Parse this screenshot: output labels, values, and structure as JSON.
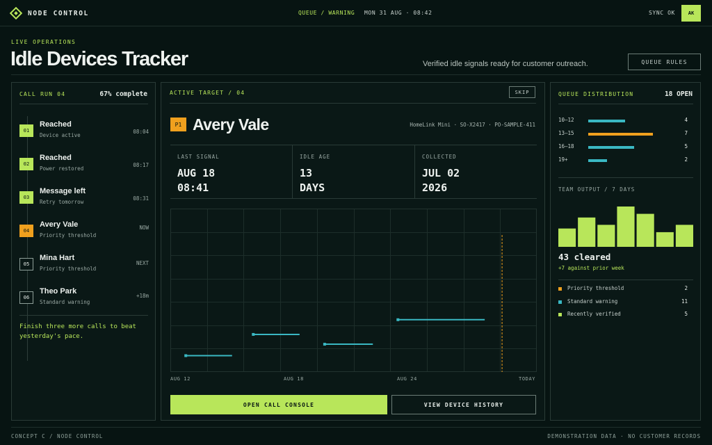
{
  "app": {
    "name": "NODE CONTROL",
    "status": "QUEUE / WARNING",
    "datetime": "MON 31 AUG · 08:42",
    "sync": "SYNC OK",
    "avatar": "AK"
  },
  "header": {
    "eyebrow": "LIVE OPERATIONS",
    "title": "Idle Devices Tracker",
    "subtitle": "Verified idle signals ready for customer outreach.",
    "queue_rules": "QUEUE RULES"
  },
  "call_run": {
    "label": "CALL RUN 04",
    "progress_text": "67% complete",
    "progress": 0.67,
    "items": [
      {
        "index": "01",
        "name": "Reached",
        "sub": "Device active",
        "time": "08:04",
        "state": "done"
      },
      {
        "index": "02",
        "name": "Reached",
        "sub": "Power restored",
        "time": "08:17",
        "state": "done"
      },
      {
        "index": "03",
        "name": "Message left",
        "sub": "Retry tomorrow",
        "time": "08:31",
        "state": "done"
      },
      {
        "index": "04",
        "name": "Avery Vale",
        "sub": "Priority threshold",
        "time": "NOW",
        "state": "now"
      },
      {
        "index": "05",
        "name": "Mina Hart",
        "sub": "Priority threshold",
        "time": "NEXT",
        "state": "next"
      },
      {
        "index": "06",
        "name": "Theo Park",
        "sub": "Standard warning",
        "time": "+18m",
        "state": "next"
      }
    ],
    "note": "Finish three more calls to beat yesterday's pace."
  },
  "target": {
    "label": "ACTIVE TARGET / 04",
    "skip": "SKIP",
    "priority": "P1",
    "name": "Avery Vale",
    "meta": "HomeLink Mini · SO-X2417 · PO-SAMPLE-411",
    "stats": [
      {
        "label": "LAST SIGNAL",
        "line1": "AUG 18",
        "line2": "08:41"
      },
      {
        "label": "IDLE AGE",
        "line1": "13",
        "line2": "DAYS"
      },
      {
        "label": "COLLECTED",
        "line1": "JUL 02",
        "line2": "2026"
      }
    ],
    "primary_action": "OPEN CALL CONSOLE",
    "secondary_action": "VIEW DEVICE HISTORY"
  },
  "chart_data": {
    "type": "scatter",
    "x_ticks": [
      "AUG 12",
      "AUG 18",
      "AUG 24",
      "TODAY"
    ],
    "x_domain_days": [
      12,
      31
    ],
    "y_range": [
      0,
      1
    ],
    "grid": true,
    "today_marker": true,
    "segments": [
      {
        "start_day": 12.8,
        "end_day": 15.2,
        "y": 0.1
      },
      {
        "start_day": 16.3,
        "end_day": 18.7,
        "y": 0.23
      },
      {
        "start_day": 20.0,
        "end_day": 22.5,
        "y": 0.17
      },
      {
        "start_day": 23.8,
        "end_day": 28.3,
        "y": 0.32
      }
    ],
    "colors": {
      "segment": "#3ab8c3",
      "today": "#f0a01e",
      "grid": "#1d2e2a"
    }
  },
  "distribution": {
    "label": "QUEUE DISTRIBUTION",
    "total": "18 OPEN",
    "max": 7,
    "rows": [
      {
        "range": "10–12",
        "count": 4,
        "color": "#3ab8c3"
      },
      {
        "range": "13–15",
        "count": 7,
        "color": "#f0a01e"
      },
      {
        "range": "16–18",
        "count": 5,
        "color": "#3ab8c3"
      },
      {
        "range": "19+",
        "count": 2,
        "color": "#3ab8c3"
      }
    ]
  },
  "team_output": {
    "label": "TEAM OUTPUT / 7 DAYS",
    "values": [
      5,
      8,
      6,
      11,
      9,
      4,
      6
    ],
    "max": 11,
    "color": "#b8e65a",
    "cleared": "43 cleared",
    "delta": "+7 against prior week"
  },
  "legend": [
    {
      "label": "Priority threshold",
      "count": "2",
      "color": "#f0a01e"
    },
    {
      "label": "Standard warning",
      "count": "11",
      "color": "#3ab8c3"
    },
    {
      "label": "Recently verified",
      "count": "5",
      "color": "#b8e65a"
    }
  ],
  "footer": {
    "left": "CONCEPT C / NODE CONTROL",
    "right": "DEMONSTRATION DATA · NO CUSTOMER RECORDS"
  },
  "theme": {
    "accent": "#b8e65a",
    "warning": "#f0a01e",
    "info": "#3ab8c3",
    "background": "#071412"
  }
}
